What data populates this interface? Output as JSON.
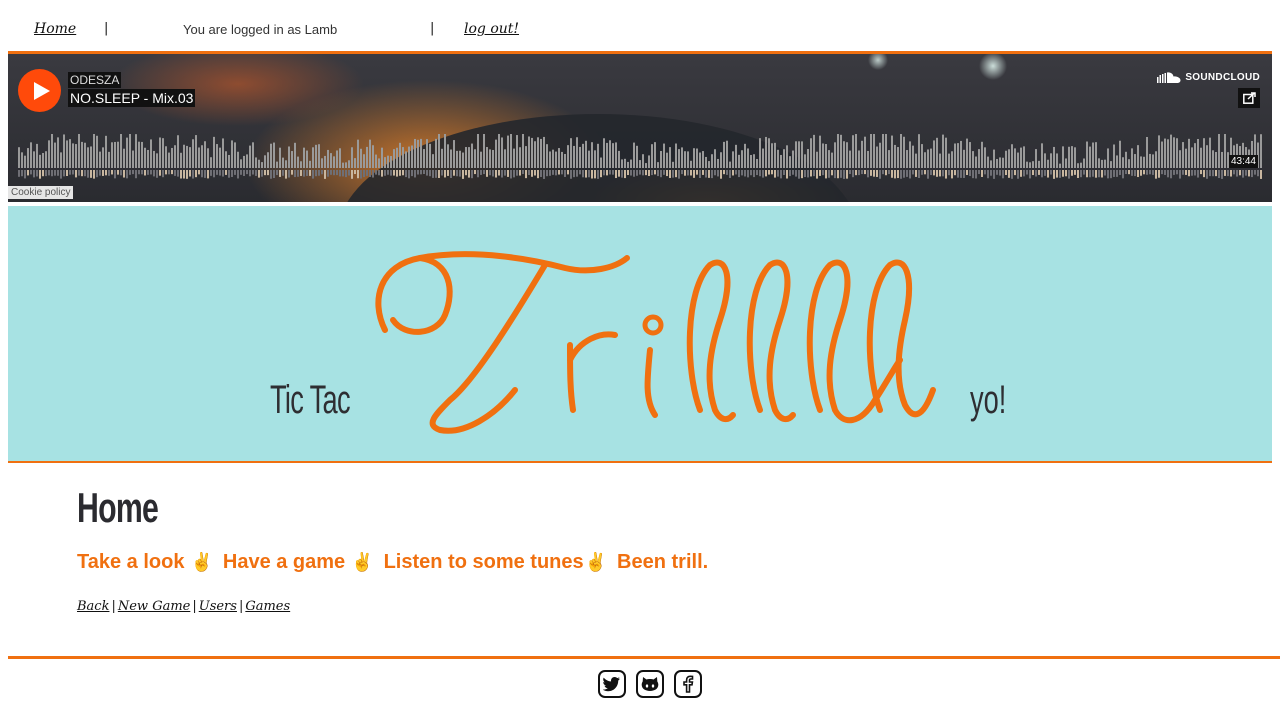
{
  "topnav": {
    "home": "Home",
    "separator": "|",
    "logged_in": "You are logged in as Lamb",
    "logout": "log out!"
  },
  "player": {
    "artist": "ODESZA",
    "track": "NO.SLEEP - Mix.03",
    "brand": "SOUNDCLOUD",
    "duration": "43:44",
    "cookie": "Cookie policy",
    "accent_color": "#ff4a0a"
  },
  "hero": {
    "left": "Tic Tac",
    "script": "Trilll",
    "right": "yo!",
    "background": "#a7e2e3",
    "script_color": "#f07010"
  },
  "main": {
    "title": "Home",
    "tagline": [
      "Take a look",
      "Have a game",
      "Listen to some tunes",
      "Been trill."
    ],
    "peace": "✌",
    "links": [
      "Back",
      "New Game",
      "Users",
      "Games"
    ],
    "pipe": "|"
  },
  "footer": {
    "icons": [
      "twitter-icon",
      "github-icon",
      "facebook-icon"
    ]
  },
  "colors": {
    "accent": "#f07010",
    "text_dark": "#2b2b30"
  }
}
